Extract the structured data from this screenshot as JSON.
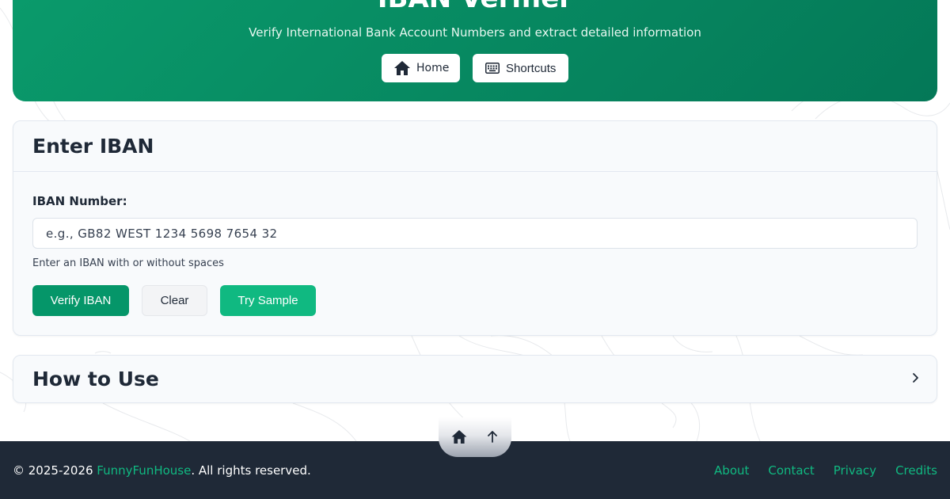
{
  "header": {
    "title": "IBAN Verifier",
    "subtitle": "Verify International Bank Account Numbers and extract detailed information",
    "nav": {
      "home_label": "Home",
      "shortcuts_label": "Shortcuts"
    }
  },
  "iban_form": {
    "title": "Enter IBAN",
    "field_label": "IBAN Number:",
    "input_value": "",
    "input_placeholder": "e.g., GB82 WEST 1234 5698 7654 32",
    "hint": "Enter an IBAN with or without spaces",
    "buttons": {
      "verify": "Verify IBAN",
      "clear": "Clear",
      "sample": "Try Sample"
    }
  },
  "how_to_use": {
    "title": "How to Use"
  },
  "quick_nav": {
    "home_icon": "home-icon",
    "top_icon": "arrow-up-icon"
  },
  "footer": {
    "copyright_prefix": "© 2025-2026 ",
    "brand": "FunnyFunHouse",
    "copyright_suffix": ". All rights reserved.",
    "links": [
      "About",
      "Contact",
      "Privacy",
      "Credits"
    ]
  },
  "colors": {
    "hero_gradient_start": "#0a9a6b",
    "hero_gradient_end": "#047857",
    "primary_button": "#059669",
    "accent_button": "#10b981",
    "link": "#10b981",
    "footer_bg": "#1f2937"
  }
}
